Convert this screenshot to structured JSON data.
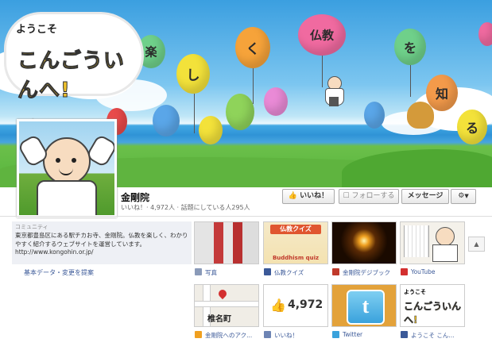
{
  "cover": {
    "logo_line1": "ようこそ",
    "logo_line2": "こんごういんへ!",
    "balloons": [
      "楽",
      "し",
      "く",
      "仏教",
      "を",
      "知",
      "る"
    ]
  },
  "page": {
    "name": "金剛院",
    "stats": "いいね！· 4,972人 · 話題にしている人295人"
  },
  "actions": {
    "like": "いいね！",
    "follow": "フォローする",
    "message": "メッセージ",
    "settings_icon": "gear-icon"
  },
  "about": {
    "label": "コミュニティ",
    "description": "東京都豊島区にある駅チカお寺、金剛院。仏教を楽しく、わかりやすく紹介するウェブサイトを運営しています。http://www.kongohin.or.jp/",
    "link": "基本データ・変更を提案"
  },
  "tiles": [
    {
      "caption": "写真",
      "icon": "photo-icon"
    },
    {
      "caption": "仏教クイズ",
      "icon": "app-icon",
      "banner": "仏教クイズ",
      "sub": "Buddhism quiz"
    },
    {
      "caption": "金剛院デジブック",
      "icon": "book-icon"
    },
    {
      "caption": "YouTube",
      "icon": "youtube-icon"
    },
    {
      "caption": "金剛院へのアク...",
      "icon": "map-pin-icon",
      "map_label": "椎名町"
    },
    {
      "caption": "いいね！",
      "icon": "like-icon",
      "count": "4,972"
    },
    {
      "caption": "Twitter",
      "icon": "twitter-icon"
    },
    {
      "caption": "ようこそ こん...",
      "icon": "app-icon"
    }
  ],
  "colors": {
    "link": "#3b5998",
    "accent": "#f0c22a"
  }
}
